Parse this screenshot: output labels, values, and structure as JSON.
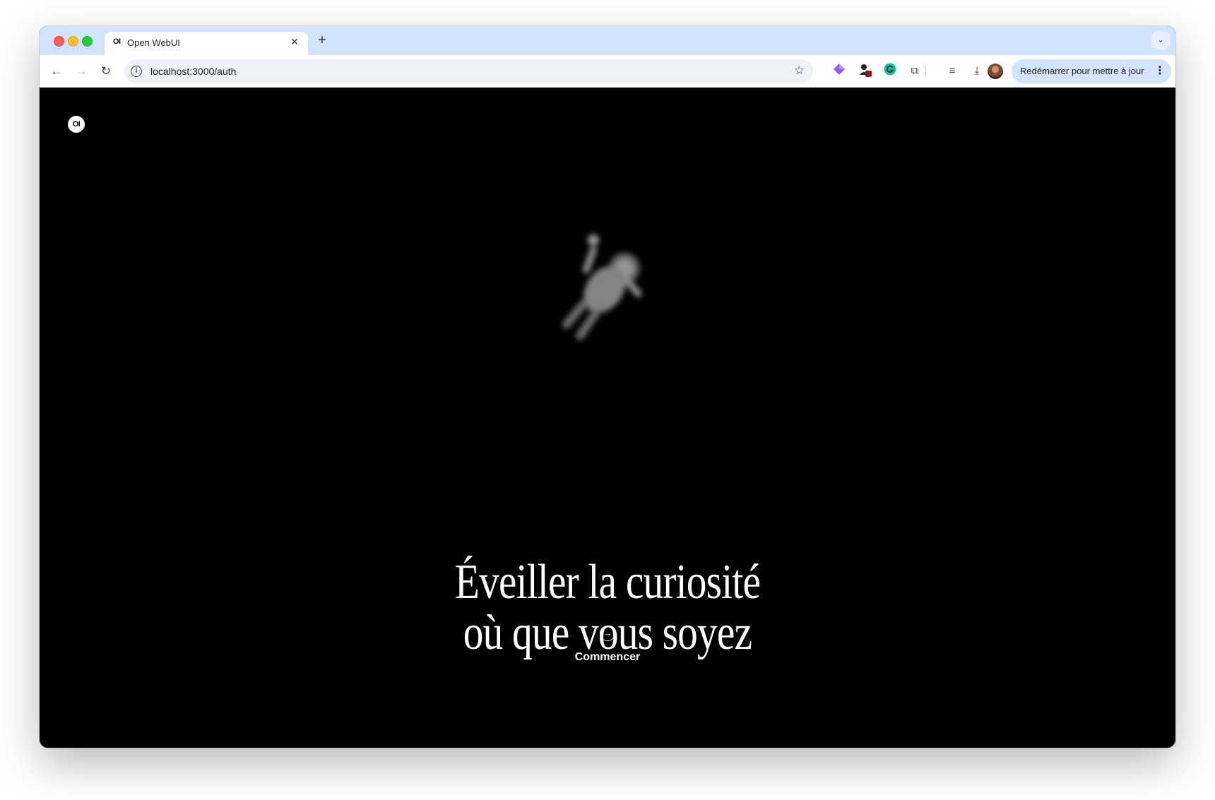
{
  "browser": {
    "tab": {
      "favicon_text": "OI",
      "title": "Open WebUI",
      "close_glyph": "✕"
    },
    "new_tab_glyph": "+",
    "tab_search_glyph": "⌄",
    "nav": {
      "back_glyph": "←",
      "forward_glyph": "→",
      "reload_glyph": "↻"
    },
    "omnibox": {
      "info_glyph": "i",
      "url": "localhost:3000/auth",
      "star_glyph": "☆"
    },
    "extensions": {
      "gem_icon": "diamond-gem-icon",
      "puzzle_glyph": "⧉",
      "queue_glyph": "≡",
      "download_glyph": "⤓"
    },
    "update_button": {
      "label": "Redémarrer pour mettre à jour",
      "kebab": "⋮"
    }
  },
  "page": {
    "logo_text": "OI",
    "headline_line1": "Éveiller la curiosité",
    "headline_line2": "où que vous soyez",
    "start_icon_glyph": "→",
    "start_label": "Commencer"
  },
  "colors": {
    "tabstrip_bg": "#d3e3fd",
    "page_bg": "#000000",
    "headline": "#ffffff"
  }
}
